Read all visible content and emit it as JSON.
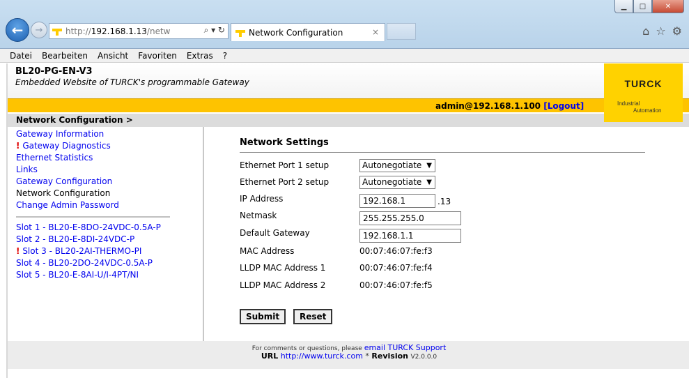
{
  "browser": {
    "url_prefix": "http://",
    "url_host": "192.168.1.13",
    "url_suffix": "/netw",
    "address_icons": "⌕ ▾ ↻",
    "tab_title": "Network Configuration",
    "tab_close": "×",
    "back_glyph": "←",
    "forward_glyph": "→",
    "toolbar_icons": [
      "home-icon",
      "favorites-star-icon",
      "settings-gear-icon"
    ],
    "window_controls": [
      "minimize",
      "maximize",
      "close"
    ]
  },
  "menu": {
    "items": [
      "Datei",
      "Bearbeiten",
      "Ansicht",
      "Favoriten",
      "Extras",
      "?"
    ]
  },
  "header": {
    "device": "BL20-PG-EN-V3",
    "subtitle": "Embedded Website of TURCK's programmable Gateway",
    "logo_text": "TURCK",
    "logo_line1": "Industrial",
    "logo_line2": "Automation",
    "user": "admin@192.168.1.100",
    "logout": "[Logout]"
  },
  "breadcrumb": "Network Configuration >",
  "sidebar": {
    "items": [
      {
        "label": "Gateway Information",
        "warn": false,
        "current": false
      },
      {
        "label": "Gateway Diagnostics",
        "warn": true,
        "current": false
      },
      {
        "label": "Ethernet Statistics",
        "warn": false,
        "current": false
      },
      {
        "label": "Links",
        "warn": false,
        "current": false
      },
      {
        "label": "Gateway Configuration",
        "warn": false,
        "current": false
      },
      {
        "label": "Network Configuration",
        "warn": false,
        "current": true
      },
      {
        "label": "Change Admin Password",
        "warn": false,
        "current": false
      }
    ],
    "slots": [
      {
        "label": "Slot 1 - BL20-E-8DO-24VDC-0.5A-P",
        "warn": false
      },
      {
        "label": "Slot 2 - BL20-E-8DI-24VDC-P",
        "warn": false
      },
      {
        "label": "Slot 3 - BL20-2AI-THERMO-PI",
        "warn": true
      },
      {
        "label": "Slot 4 - BL20-2DO-24VDC-0.5A-P",
        "warn": false
      },
      {
        "label": "Slot 5 - BL20-E-8AI-U/I-4PT/NI",
        "warn": false
      }
    ],
    "warn_mark": "!"
  },
  "form": {
    "heading": "Network Settings",
    "port1_label": "Ethernet Port 1 setup",
    "port1_value": "Autonegotiate",
    "port2_label": "Ethernet Port 2 setup",
    "port2_value": "Autonegotiate",
    "ip_label": "IP Address",
    "ip_value": "192.168.1",
    "ip_suffix": ".13",
    "netmask_label": "Netmask",
    "netmask_value": "255.255.255.0",
    "gateway_label": "Default Gateway",
    "gateway_value": "192.168.1.1",
    "mac_label": "MAC Address",
    "mac_value": "00:07:46:07:fe:f3",
    "lldp1_label": "LLDP MAC Address 1",
    "lldp1_value": "00:07:46:07:fe:f4",
    "lldp2_label": "LLDP MAC Address 2",
    "lldp2_value": "00:07:46:07:fe:f5",
    "submit": "Submit",
    "reset": "Reset"
  },
  "footer": {
    "text1": "For comments or questions, please",
    "support_link": "email TURCK Support",
    "url_label": "URL",
    "url": "http://www.turck.com",
    "sep": "*",
    "revision_label": "Revision",
    "revision": "V2.0.0.0"
  }
}
